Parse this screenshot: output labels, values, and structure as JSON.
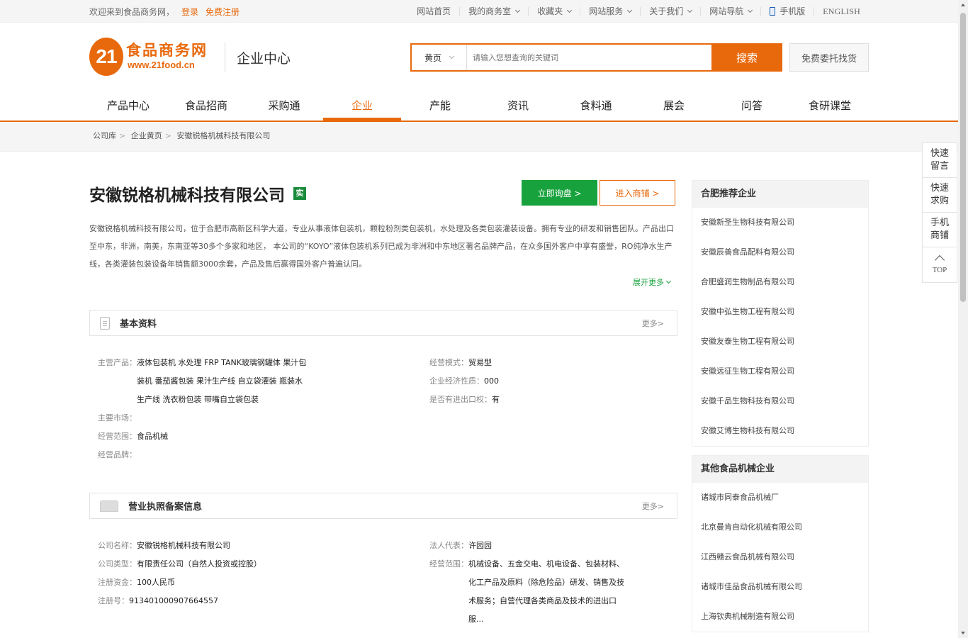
{
  "topbar": {
    "welcome": "欢迎来到食品商务网，",
    "login": "登录",
    "register": "免费注册",
    "links": [
      "网站首页",
      "我的商务室",
      "收藏夹",
      "网站服务",
      "关于我们",
      "网站导航",
      "手机版",
      "ENGLISH"
    ]
  },
  "header": {
    "logo_num": "21",
    "logo_cn": "食品商务网",
    "logo_en": "www.21food.cn",
    "center_title": "企业中心",
    "search_type": "黄页",
    "search_placeholder": "请输入您想查询的关键词",
    "search_button": "搜索",
    "entrust_button": "免费委托找货"
  },
  "nav": [
    "产品中心",
    "食品招商",
    "采购通",
    "企业",
    "产能",
    "资讯",
    "食料通",
    "展会",
    "问答",
    "食研课堂"
  ],
  "breadcrumb": [
    "公司库",
    "企业黄页",
    "安徽锐格机械科技有限公司"
  ],
  "company": {
    "name": "安徽锐格机械科技有限公司",
    "badge": "实",
    "inquiry_button": "立即询盘 >",
    "shop_button": "进入商铺 >",
    "intro": "安徽锐格机械科技有限公司，位于合肥市高新区科学大道，专业从事液体包装机，颗粒粉剂类包装机，水处理及各类包装灌装设备。拥有专业的研发和销售团队。产品出口至中东，非洲，南美，东南亚等30多个多家和地区， 本公司的“KOYO”液体包装机系列已成为非洲和中东地区著名品牌产品，在众多国外客户中享有盛誉，RO纯净水生产线，各类灌装包装设备年销售额3000余套，产品及售后赢得国外客户普遍认同。",
    "expand_more": "展开更多"
  },
  "basic": {
    "title": "基本资料",
    "more": "更多>",
    "main_products_key": "主营产品：",
    "main_products_lines": [
      "液体包装机 水处理 FRP TANK玻璃钢罐体 果汁包",
      "装机 番茄酱包装 果汁生产线 自立袋灌装 瓶装水",
      "生产线 洗衣粉包装 带嘴自立袋包装"
    ],
    "market_key": "主要市场：",
    "market_val": "",
    "scope_key": "经营范围：",
    "scope_val": "食品机械",
    "brand_key": "经营品牌：",
    "brand_val": "",
    "mode_key": "经营模式：",
    "mode_val": "贸易型",
    "nature_key": "企业经济性质：",
    "nature_val": "000",
    "import_key": "是否有进出口权：",
    "import_val": "有"
  },
  "license": {
    "title": "营业执照备案信息",
    "more": "更多>",
    "name_key": "公司名称：",
    "name_val": "安徽锐格机械科技有限公司",
    "type_key": "公司类型：",
    "type_val": "有限责任公司（自然人投资或控股）",
    "capital_key": "注册资金：",
    "capital_val": "100人民币",
    "regno_key": "注册号：",
    "regno_val": "913401000907664557",
    "legal_key": "法人代表：",
    "legal_val": "许园园",
    "scope_key": "经营范围：",
    "scope_lines": [
      "机械设备、五金交电、机电设备、包装材料、",
      "化工产品及原料（除危险品）研发、销售及技",
      "术服务；自营代理各类商品及技术的进出口",
      "服..."
    ]
  },
  "sidebar": {
    "recommend_title": "合肥推荐企业",
    "recommend": [
      "安徽新圣生物科技有限公司",
      "安徽辰善食品配料有限公司",
      "合肥盛润生物制品有限公司",
      "安徽中弘生物工程有限公司",
      "安徽友泰生物工程有限公司",
      "安徽远征生物工程有限公司",
      "安徽千品生物科技有限公司",
      "安徽艾博生物科技有限公司"
    ],
    "other_title": "其他食品机械企业",
    "other": [
      "诸城市同泰食品机械厂",
      "北京曼肯自动化机械有限公司",
      "江西赣云食品机械有限公司",
      "诸城市佳品食品机械有限公司",
      "上海钦典机械制造有限公司"
    ]
  },
  "float": {
    "items": [
      "快速留言",
      "快速求购",
      "手机商铺"
    ],
    "top": "TOP"
  },
  "colors": {
    "accent": "#e8690c",
    "green": "#18a23d"
  }
}
